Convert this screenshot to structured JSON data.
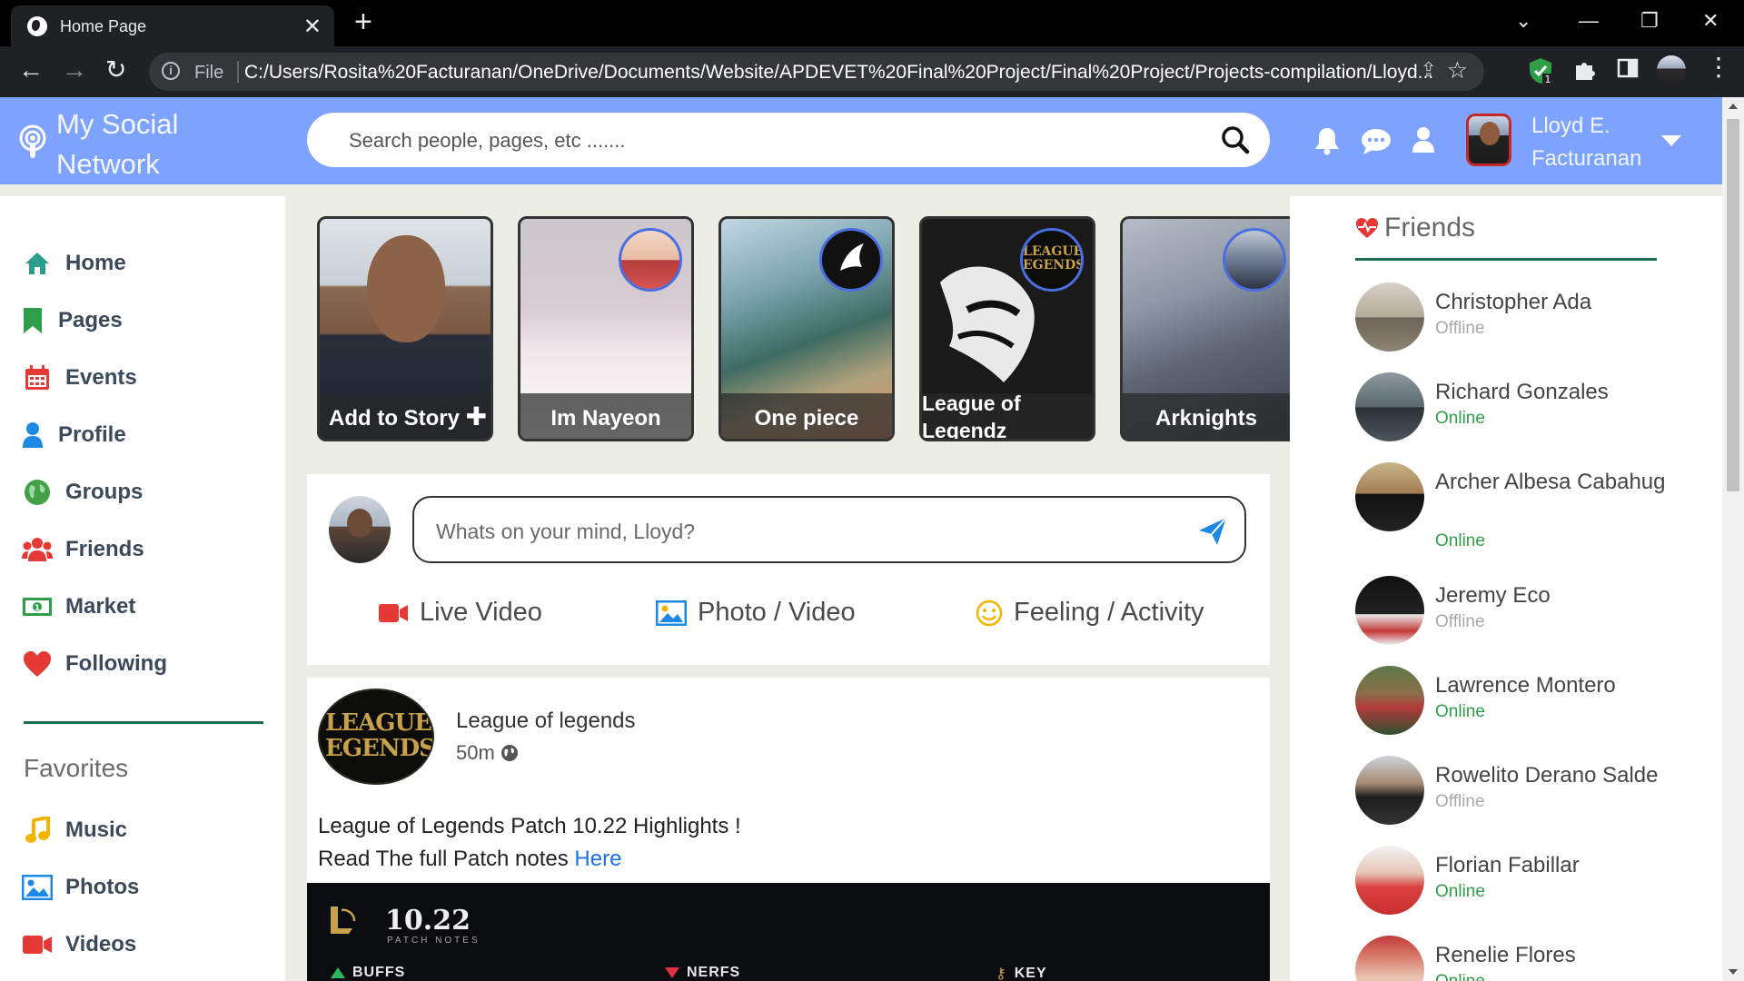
{
  "browser": {
    "tab_title": "Home Page",
    "scheme_label": "File",
    "url": "C:/Users/Rosita%20Facturanan/OneDrive/Documents/Website/APDEVET%20Final%20Project/Final%20Project/Projects-compilation/Lloyd...",
    "extension_badge": "1"
  },
  "header": {
    "brand": "My Social Network",
    "search_placeholder": "Search people, pages, etc .......",
    "user_name": "Lloyd E. Facturanan"
  },
  "sidebar": {
    "items": [
      {
        "label": "Home",
        "icon": "home-icon",
        "color": "#2a9d8f"
      },
      {
        "label": "Pages",
        "icon": "bookmark-icon",
        "color": "#2e9e48"
      },
      {
        "label": "Events",
        "icon": "calendar-icon",
        "color": "#e53935"
      },
      {
        "label": "Profile",
        "icon": "user-icon",
        "color": "#1e88e5"
      },
      {
        "label": "Groups",
        "icon": "globe-icon",
        "color": "#43a047"
      },
      {
        "label": "Friends",
        "icon": "users-icon",
        "color": "#e53935"
      },
      {
        "label": "Market",
        "icon": "money-icon",
        "color": "#2e9e48"
      },
      {
        "label": "Following",
        "icon": "heart-icon",
        "color": "#e53935"
      }
    ],
    "favorites_heading": "Favorites",
    "favorites": [
      {
        "label": "Music",
        "icon": "music-icon",
        "color": "#f4b400"
      },
      {
        "label": "Photos",
        "icon": "image-icon",
        "color": "#1e88e5"
      },
      {
        "label": "Videos",
        "icon": "video-icon",
        "color": "#e53935"
      }
    ]
  },
  "stories": [
    {
      "label": "Add to Story"
    },
    {
      "label": "Im Nayeon"
    },
    {
      "label": "One piece"
    },
    {
      "label": "League of Legendz"
    },
    {
      "label": "Arknights"
    }
  ],
  "composer": {
    "placeholder": "Whats on your mind, Lloyd?",
    "actions": [
      {
        "label": "Live Video",
        "icon": "video-camera-icon"
      },
      {
        "label": "Photo / Video",
        "icon": "image-icon"
      },
      {
        "label": "Feeling / Activity",
        "icon": "smile-icon"
      }
    ]
  },
  "post": {
    "avatar_text": "LEAGUE EGENDS",
    "author": "League of legends",
    "time": "50m",
    "text_line1": "League of Legends Patch 10.22 Highlights !",
    "text_line2": "Read The full Patch notes ",
    "link": "Here",
    "banner": {
      "version": "10.22",
      "subtitle": "PATCH NOTES",
      "buffs": "BUFFS",
      "nerfs": "NERFS",
      "key": "KEY"
    }
  },
  "friends": {
    "title": "Friends",
    "list": [
      {
        "name": "Christopher Ada",
        "status": "Offline"
      },
      {
        "name": "Richard Gonzales",
        "status": "Online"
      },
      {
        "name": "Archer Albesa Cabahug",
        "status": "Online"
      },
      {
        "name": "Jeremy Eco",
        "status": "Offline"
      },
      {
        "name": "Lawrence Montero",
        "status": "Online"
      },
      {
        "name": "Rowelito Derano Salde",
        "status": "Offline"
      },
      {
        "name": "Florian Fabillar",
        "status": "Online"
      },
      {
        "name": "Renelie Flores",
        "status": "Online"
      }
    ]
  },
  "colors": {
    "header_bg": "#7da3ff",
    "accent_rule": "#1d6a53",
    "online": "#2e9e48",
    "offline": "#a9a9a9",
    "link": "#1a73e8"
  }
}
